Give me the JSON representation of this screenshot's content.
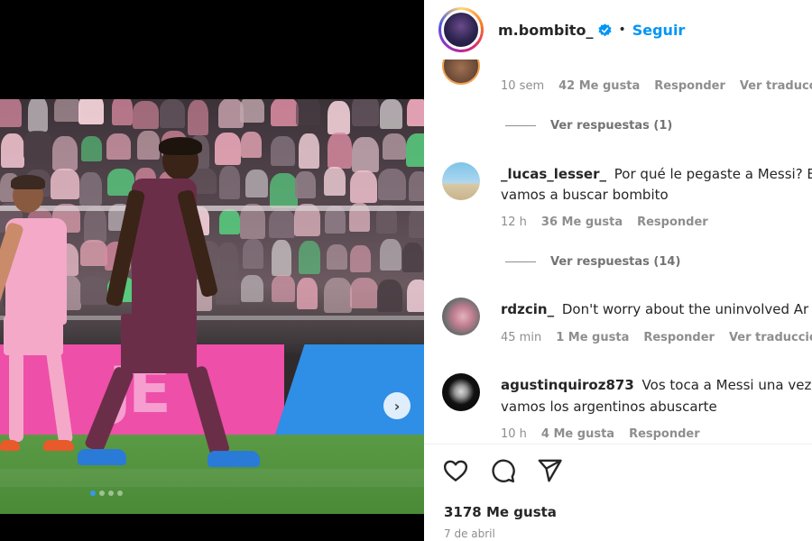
{
  "post": {
    "username": "m.bombito_",
    "follow_label": "Seguir",
    "separator": "•",
    "likes": "3178 Me gusta",
    "date": "7 de abril"
  },
  "carousel": {
    "dots": 4,
    "active_index": 0,
    "ad_text": "JE"
  },
  "comments": [
    {
      "username": "",
      "text": "",
      "meta": [
        "10 sem",
        "42 Me gusta",
        "Responder",
        "Ver traducción"
      ],
      "replies": "Ver respuestas (1)"
    },
    {
      "username": "_lucas_lesser_",
      "text": "Por qué le pegaste a Messi? E",
      "text_line2": "vamos a buscar bombito",
      "meta": [
        "12 h",
        "36 Me gusta",
        "Responder"
      ],
      "replies": "Ver respuestas (14)"
    },
    {
      "username": "rdzcin_",
      "text": "Don't worry about the uninvolved Ar",
      "meta": [
        "45 min",
        "1 Me gusta",
        "Responder",
        "Ver traducción"
      ]
    },
    {
      "username": "agustinquiroz873",
      "text": "Vos toca a Messi una vez",
      "text_line2": "vamos los argentinos abuscarte",
      "meta": [
        "10 h",
        "4 Me gusta",
        "Responder"
      ]
    }
  ],
  "colors": {
    "accent": "#0095f6",
    "verified": "#0095f6",
    "muted": "#8e8e8e"
  },
  "icons": [
    "heart-icon",
    "comment-icon",
    "share-icon",
    "verified-badge-icon",
    "chevron-right-icon"
  ]
}
